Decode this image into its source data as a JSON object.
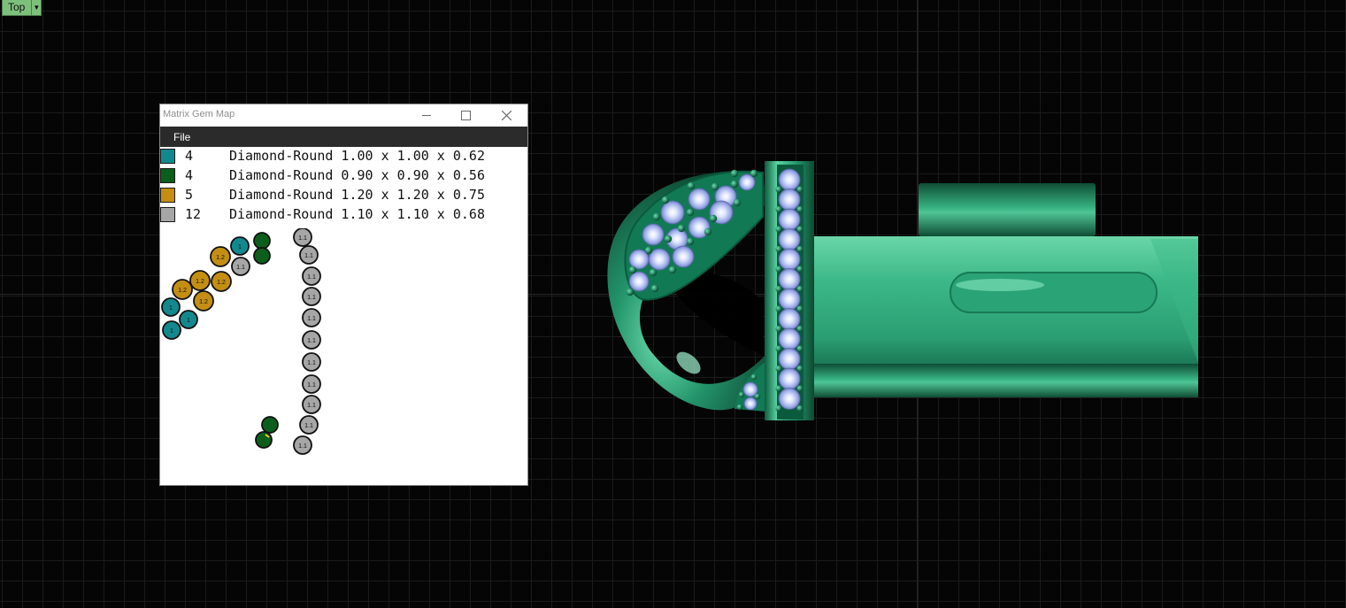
{
  "viewport": {
    "name": "Top"
  },
  "gem_window": {
    "title": "Matrix Gem Map",
    "menu": [
      "File"
    ],
    "legend": [
      {
        "color": "#12898e",
        "count": "4",
        "description": "Diamond-Round 1.00 x 1.00 x 0.62",
        "size_label": "1"
      },
      {
        "color": "#0c5e1c",
        "count": "4",
        "description": "Diamond-Round 0.90 x 0.90 x 0.56",
        "size_label": "0.9"
      },
      {
        "color": "#c48e12",
        "count": "5",
        "description": "Diamond-Round 1.20 x 1.20 x 0.75",
        "size_label": "1.2"
      },
      {
        "color": "#a6a6a6",
        "count": "12",
        "description": "Diamond-Round 1.10 x 1.10 x 0.68",
        "size_label": "1.1"
      }
    ]
  },
  "colors": {
    "metal": "#2a9e72",
    "metal_dark": "#0f4d35",
    "stone": "#b9c8ff",
    "prong": "#0e7a55"
  }
}
